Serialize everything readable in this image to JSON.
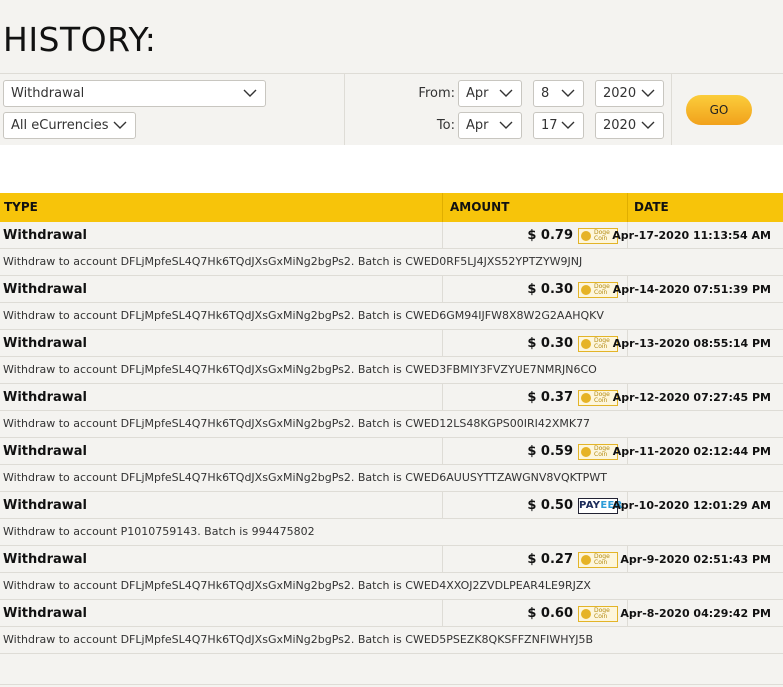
{
  "page": {
    "title": "HISTORY:"
  },
  "filters": {
    "type_value": "Withdrawal",
    "currency_value": "All eCurrencies",
    "from_label": "From:",
    "to_label": "To:",
    "from_month": "Apr",
    "from_day": "8",
    "from_year": "2020",
    "to_month": "Apr",
    "to_day": "17",
    "to_year": "2020",
    "go_label": "GO"
  },
  "table": {
    "headers": {
      "type": "TYPE",
      "amount": "AMOUNT",
      "date": "DATE"
    },
    "rows": [
      {
        "type": "Withdrawal",
        "amount": "$ 0.79",
        "currency_icon": "dogecoin-icon",
        "date": "Apr-17-2020 11:13:54 AM",
        "description": "Withdraw to account DFLjMpfeSL4Q7Hk6TQdJXsGxMiNg2bgPs2. Batch is CWED0RF5LJ4JXS52YPTZYW9JNJ"
      },
      {
        "type": "Withdrawal",
        "amount": "$ 0.30",
        "currency_icon": "dogecoin-icon",
        "date": "Apr-14-2020 07:51:39 PM",
        "description": "Withdraw to account DFLjMpfeSL4Q7Hk6TQdJXsGxMiNg2bgPs2. Batch is CWED6GM94IJFW8X8W2G2AAHQKV"
      },
      {
        "type": "Withdrawal",
        "amount": "$ 0.30",
        "currency_icon": "dogecoin-icon",
        "date": "Apr-13-2020 08:55:14 PM",
        "description": "Withdraw to account DFLjMpfeSL4Q7Hk6TQdJXsGxMiNg2bgPs2. Batch is CWED3FBMIY3FVZYUE7NMRJN6CO"
      },
      {
        "type": "Withdrawal",
        "amount": "$ 0.37",
        "currency_icon": "dogecoin-icon",
        "date": "Apr-12-2020 07:27:45 PM",
        "description": "Withdraw to account DFLjMpfeSL4Q7Hk6TQdJXsGxMiNg2bgPs2. Batch is CWED12LS48KGPS00IRI42XMK77"
      },
      {
        "type": "Withdrawal",
        "amount": "$ 0.59",
        "currency_icon": "dogecoin-icon",
        "date": "Apr-11-2020 02:12:44 PM",
        "description": "Withdraw to account DFLjMpfeSL4Q7Hk6TQdJXsGxMiNg2bgPs2. Batch is CWED6AUUSYTTZAWGNV8VQKTPWT"
      },
      {
        "type": "Withdrawal",
        "amount": "$ 0.50",
        "currency_icon": "payeer-icon",
        "date": "Apr-10-2020 12:01:29 AM",
        "description": "Withdraw to account P1010759143. Batch is 994475802"
      },
      {
        "type": "Withdrawal",
        "amount": "$ 0.27",
        "currency_icon": "dogecoin-icon",
        "date": "Apr-9-2020 02:51:43 PM",
        "description": "Withdraw to account DFLjMpfeSL4Q7Hk6TQdJXsGxMiNg2bgPs2. Batch is CWED4XXOJ2ZVDLPEAR4LE9RJZX"
      },
      {
        "type": "Withdrawal",
        "amount": "$ 0.60",
        "currency_icon": "dogecoin-icon",
        "date": "Apr-8-2020 04:29:42 PM",
        "description": "Withdraw to account DFLjMpfeSL4Q7Hk6TQdJXsGxMiNg2bgPs2. Batch is CWED5PSEZK8QKSFFZNFIWHYJ5B"
      }
    ]
  },
  "icons": {
    "doge_label_1": "Doge",
    "doge_label_2": "Coin",
    "payeer_label_1": "PAY",
    "payeer_label_2": "EER"
  },
  "colors": {
    "accent": "#f7c40a",
    "go_button": "#f5b52a",
    "background": "#f4f3f0"
  }
}
